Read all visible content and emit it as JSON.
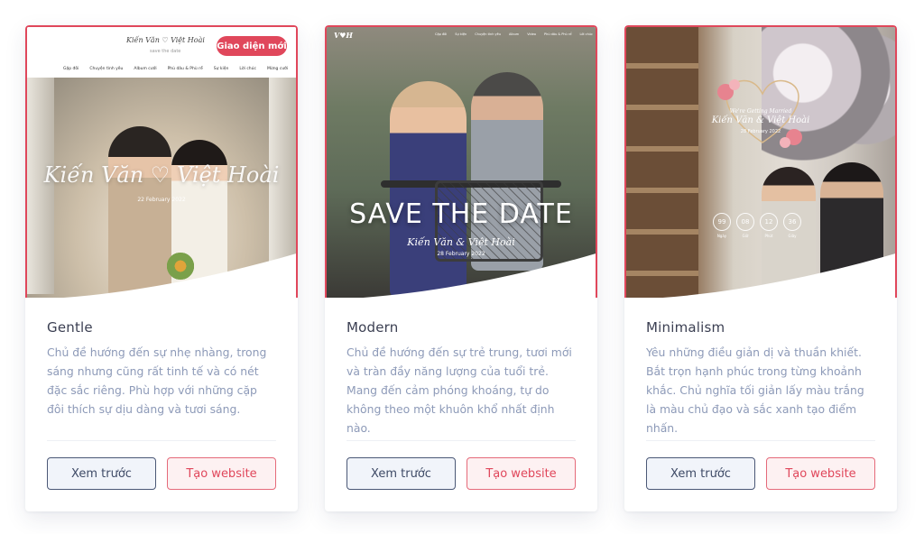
{
  "cards": [
    {
      "title": "Gentle",
      "description": "Chủ đề hướng đến sự nhẹ nhàng, trong sáng nhưng cũng rất tinh tế và có nét đặc sắc riêng. Phù hợp với những cặp đôi thích sự dịu dàng và tươi sáng.",
      "preview_label": "Xem trước",
      "create_label": "Tạo website",
      "thumb": {
        "brand": "Kiến Văn ♡ Việt Hoài",
        "brand_sub": "save the date",
        "pill": "Giao diện mới",
        "nav": [
          "Gặp đôi",
          "Chuyện tình yêu",
          "Album cưới",
          "Phù dâu & Phù rể",
          "Sự kiện",
          "Lời chúc",
          "Mừng cưới"
        ],
        "names": "Kiến Văn ♡ Việt Hoài",
        "date": "22 February 2022"
      }
    },
    {
      "title": "Modern",
      "description": "Chủ đề hướng đến sự trẻ trung, tươi mới và tràn đầy năng lượng của tuổi trẻ. Mang đến cảm phóng khoáng, tự do không theo một khuôn khổ nhất định nào.",
      "preview_label": "Xem trước",
      "create_label": "Tạo website",
      "thumb": {
        "logo": "V♥H",
        "nav": [
          "Cặp đôi",
          "Sự kiện",
          "Chuyện tình yêu",
          "Album",
          "Video",
          "Phù dâu & Phù rể",
          "Lời chúc"
        ],
        "headline": "SAVE THE DATE",
        "names": "Kiến Văn & Việt Hoài",
        "date": "28 February 2022"
      }
    },
    {
      "title": "Minimalism",
      "description": "Yêu những điều giản dị và thuần khiết. Bắt trọn hạnh phúc trong từng khoảnh khắc. Chủ nghĩa tối giản lấy màu trắng là màu chủ đạo và sắc xanh tạo điểm nhấn.",
      "preview_label": "Xem trước",
      "create_label": "Tạo website",
      "thumb": {
        "tagline": "We're Getting Married",
        "names": "Kiến Văn & Việt Hoài",
        "date": "28 February 2022",
        "countdown": [
          {
            "value": "99",
            "label": "Ngày"
          },
          {
            "value": "08",
            "label": "Giờ"
          },
          {
            "value": "12",
            "label": "Phút"
          },
          {
            "value": "36",
            "label": "Giây"
          }
        ]
      }
    }
  ],
  "colors": {
    "accent": "#e0475b",
    "title": "#3b3f52",
    "description": "#8d9ab8",
    "preview_border": "#4b5876"
  }
}
